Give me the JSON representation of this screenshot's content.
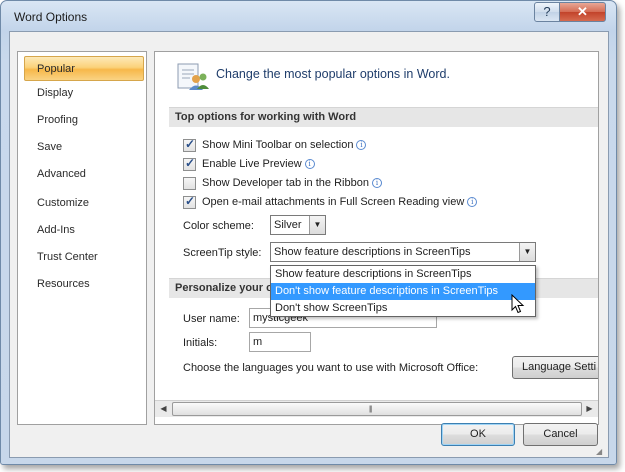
{
  "window": {
    "title": "Word Options",
    "help_glyph": "?",
    "close_glyph": "✕"
  },
  "sidebar": {
    "items": [
      {
        "label": "Popular"
      },
      {
        "label": "Display"
      },
      {
        "label": "Proofing"
      },
      {
        "label": "Save"
      },
      {
        "label": "Advanced"
      },
      {
        "label": "Customize"
      },
      {
        "label": "Add-Ins"
      },
      {
        "label": "Trust Center"
      },
      {
        "label": "Resources"
      }
    ],
    "selected": "Popular"
  },
  "content": {
    "header": "Change the most popular options in Word.",
    "section1": "Top options for working with Word",
    "options": [
      {
        "label": "Show Mini Toolbar on selection",
        "checked": true,
        "info": true
      },
      {
        "label": "Enable Live Preview",
        "checked": true,
        "info": true
      },
      {
        "label": "Show Developer tab in the Ribbon",
        "checked": false,
        "info": true
      },
      {
        "label": "Open e-mail attachments in Full Screen Reading view",
        "checked": true,
        "info": true
      }
    ],
    "color_scheme": {
      "label": "Color scheme:",
      "value": "Silver"
    },
    "screentip": {
      "label": "ScreenTip style:",
      "value": "Show feature descriptions in ScreenTips",
      "options": [
        "Show feature descriptions in ScreenTips",
        "Don't show feature descriptions in ScreenTips",
        "Don't show ScreenTips"
      ],
      "highlighted": "Don't show feature descriptions in ScreenTips"
    },
    "section2": "Personalize your c",
    "user_name": {
      "label": "User name:",
      "value": "mysticgeek"
    },
    "initials": {
      "label": "Initials:",
      "value": "m"
    },
    "languages": {
      "label": "Choose the languages you want to use with Microsoft Office:",
      "button": "Language Setti"
    }
  },
  "footer": {
    "ok": "OK",
    "cancel": "Cancel"
  },
  "scrollbar": {
    "left_arrow": "◀",
    "right_arrow": "▶",
    "grip": "|||"
  },
  "icon_glyph_info": "i",
  "colors": {
    "selected_bg": "#fbd27a",
    "highlight": "#3399ff",
    "header_text": "#1f3d6b"
  }
}
